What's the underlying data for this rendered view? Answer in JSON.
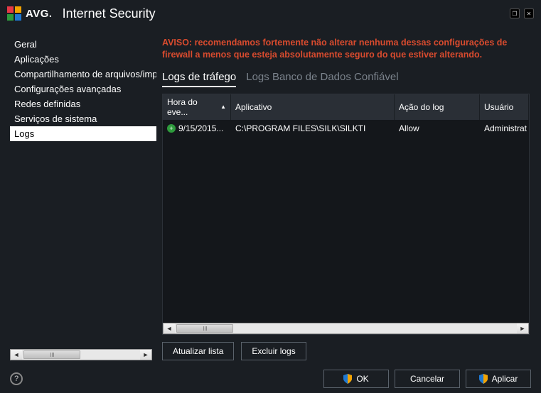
{
  "brand": "AVG",
  "title": "Internet Security",
  "sidebar": {
    "items": [
      {
        "label": "Geral"
      },
      {
        "label": "Aplicações"
      },
      {
        "label": "Compartilhamento de arquivos/impressoras"
      },
      {
        "label": "Configurações avançadas"
      },
      {
        "label": "Redes definidas"
      },
      {
        "label": "Serviços de sistema"
      },
      {
        "label": "Logs"
      }
    ],
    "active_index": 6
  },
  "warning": "AVISO: recomendamos fortemente não alterar nenhuma dessas configurações de firewall a menos que esteja absolutamente seguro do que estiver alterando.",
  "tabs": {
    "items": [
      {
        "label": "Logs de tráfego"
      },
      {
        "label": "Logs Banco de Dados Confiável"
      }
    ],
    "active_index": 0
  },
  "table": {
    "columns": [
      {
        "label": "Hora do eve...",
        "sort": "asc"
      },
      {
        "label": "Aplicativo"
      },
      {
        "label": "Ação do log"
      },
      {
        "label": "Usuário"
      }
    ],
    "rows": [
      {
        "icon": "plus",
        "time": "9/15/2015...",
        "app": "C:\\PROGRAM FILES\\SILK\\SILKTI",
        "action": "Allow",
        "user": "Administrat"
      }
    ]
  },
  "actions": {
    "refresh": "Atualizar lista",
    "delete": "Excluir logs"
  },
  "footer": {
    "ok": "OK",
    "cancel": "Cancelar",
    "apply": "Aplicar"
  }
}
